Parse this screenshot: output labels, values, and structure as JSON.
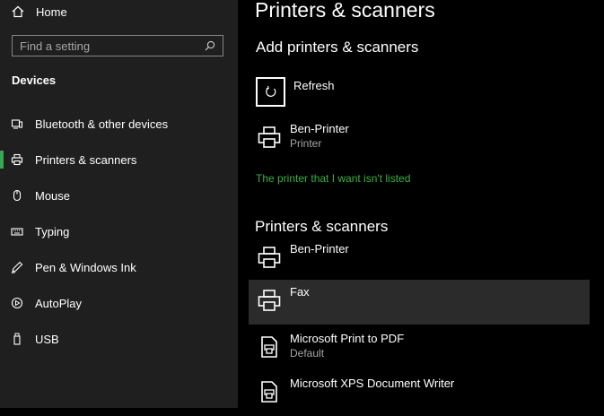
{
  "sidebar": {
    "home_label": "Home",
    "search_placeholder": "Find a setting",
    "section_title": "Devices",
    "accent_color": "#34a853",
    "items": [
      {
        "label": "Bluetooth & other devices",
        "icon": "bluetooth-devices-icon"
      },
      {
        "label": "Printers & scanners",
        "icon": "printer-icon",
        "active": true
      },
      {
        "label": "Mouse",
        "icon": "mouse-icon"
      },
      {
        "label": "Typing",
        "icon": "keyboard-icon"
      },
      {
        "label": "Pen & Windows Ink",
        "icon": "pen-icon"
      },
      {
        "label": "AutoPlay",
        "icon": "autoplay-icon"
      },
      {
        "label": "USB",
        "icon": "usb-icon"
      }
    ]
  },
  "main": {
    "title": "Printers & scanners",
    "add_title": "Add printers & scanners",
    "refresh_label": "Refresh",
    "found_devices": [
      {
        "name": "Ben-Printer",
        "status": "Printer"
      }
    ],
    "not_listed_link": "The printer that I want isn't listed",
    "link_color": "#3cb043",
    "list_title": "Printers & scanners",
    "devices": [
      {
        "name": "Ben-Printer",
        "status": "",
        "icon": "printer-icon"
      },
      {
        "name": "Fax",
        "status": "",
        "icon": "printer-icon",
        "selected": true
      },
      {
        "name": "Microsoft Print to PDF",
        "status": "Default",
        "icon": "document-printer-icon"
      },
      {
        "name": "Microsoft XPS Document Writer",
        "status": "",
        "icon": "document-printer-icon"
      }
    ]
  }
}
